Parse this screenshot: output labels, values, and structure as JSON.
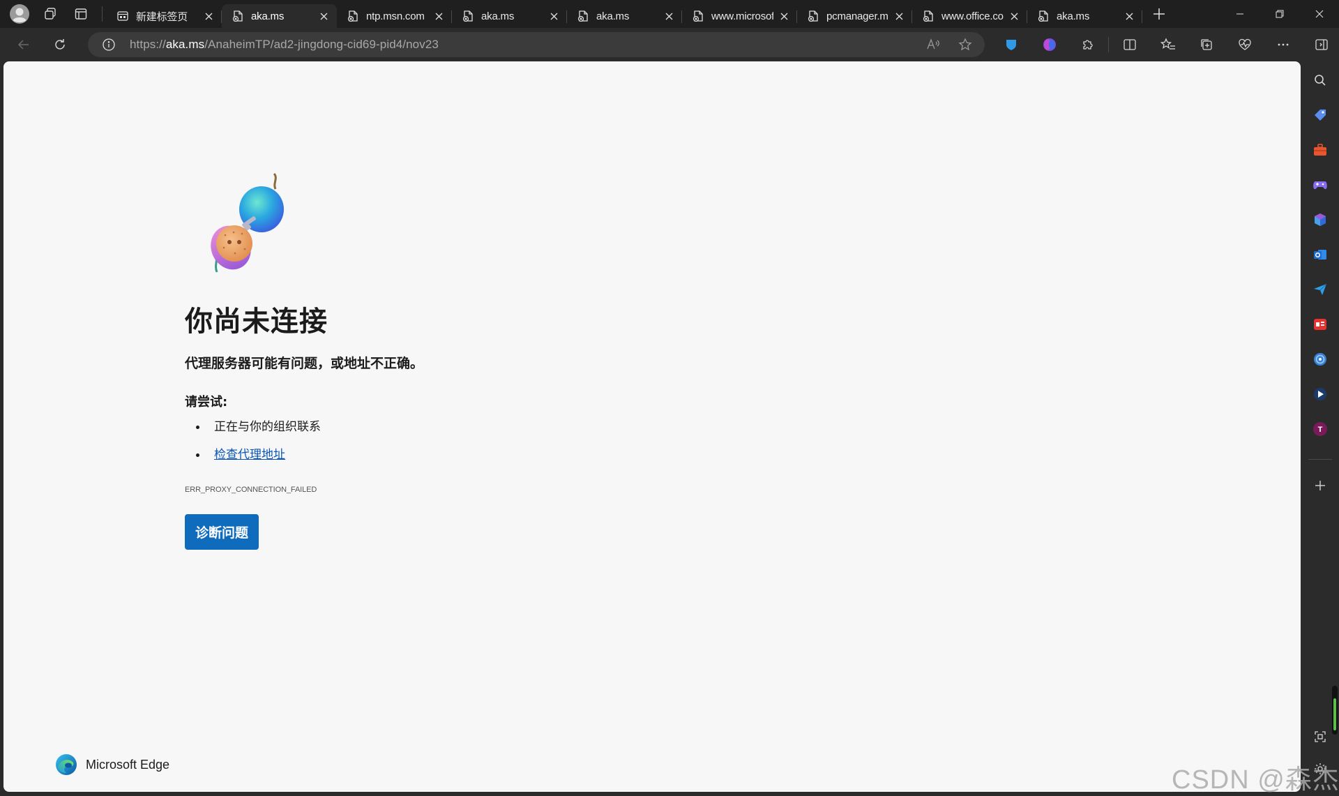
{
  "tabs": [
    {
      "title": "新建标签页",
      "icon": "new-tab-page-icon",
      "active": false
    },
    {
      "title": "aka.ms",
      "icon": "broken-page-icon",
      "active": true
    },
    {
      "title": "ntp.msn.com",
      "icon": "broken-page-icon",
      "active": false
    },
    {
      "title": "aka.ms",
      "icon": "broken-page-icon",
      "active": false
    },
    {
      "title": "aka.ms",
      "icon": "broken-page-icon",
      "active": false
    },
    {
      "title": "www.microsoft",
      "icon": "broken-page-icon",
      "active": false
    },
    {
      "title": "pcmanager.microsoft",
      "icon": "broken-page-icon",
      "active": false
    },
    {
      "title": "www.office.com",
      "icon": "broken-page-icon",
      "active": false
    },
    {
      "title": "aka.ms",
      "icon": "broken-page-icon",
      "active": false
    }
  ],
  "address_bar": {
    "url_prefix": "https://",
    "url_host": "aka.ms",
    "url_path": "/AnaheimTP/ad2-jingdong-cid69-pid4/nov23"
  },
  "error_page": {
    "title": "你尚未连接",
    "subtitle": "代理服务器可能有问题，或地址不正确。",
    "try_heading": "请尝试:",
    "suggestions": [
      {
        "text": "正在与你的组织联系",
        "link": false
      },
      {
        "text": "检查代理地址",
        "link": true
      }
    ],
    "error_code": "ERR_PROXY_CONNECTION_FAILED",
    "diagnose_button": "诊断问题",
    "brand_name": "Microsoft Edge"
  },
  "sidebar": {
    "items": [
      {
        "name": "search",
        "color": "#d6d6d6"
      },
      {
        "name": "shopping",
        "color": "#5b8def"
      },
      {
        "name": "tools",
        "color": "#e8552f"
      },
      {
        "name": "games",
        "color": "#8a6cf0"
      },
      {
        "name": "microsoft-365",
        "color": "#4aa0e8"
      },
      {
        "name": "outlook",
        "color": "#1f7ae0"
      },
      {
        "name": "send",
        "color": "#2fa0e8"
      },
      {
        "name": "toutiao",
        "color": "#e8322f"
      },
      {
        "name": "copilot",
        "color": "#3b82d6"
      },
      {
        "name": "media",
        "color": "#1a3a6a"
      },
      {
        "name": "profile-t",
        "color": "#7a1a5a"
      }
    ],
    "add_label": "+"
  },
  "watermark": "CSDN @森杰."
}
